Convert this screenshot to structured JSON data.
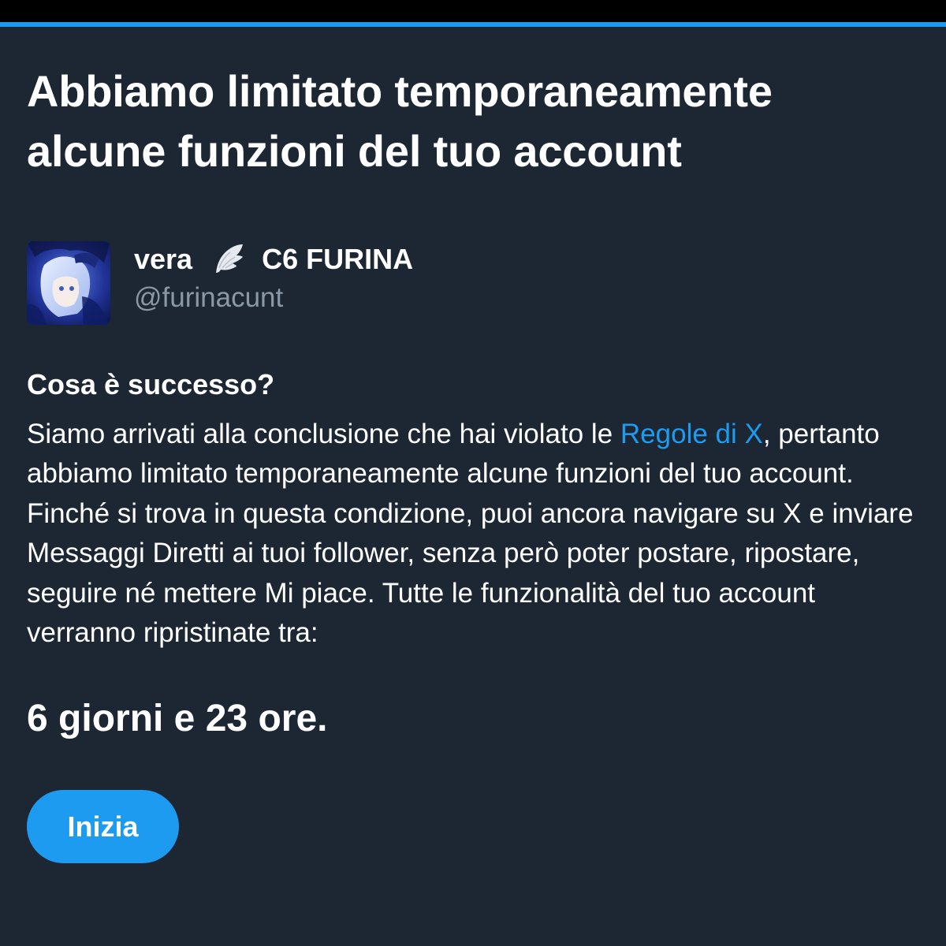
{
  "header": {
    "title": "Abbiamo limitato temporaneamente alcune funzioni del tuo account"
  },
  "account": {
    "display_name_prefix": "vera",
    "display_name_suffix": "C6 FURINA",
    "emoji_icon": "wing-icon",
    "handle": "@furinacunt"
  },
  "details": {
    "heading": "Cosa è successo?",
    "text_before_link": "Siamo arrivati alla conclusione che hai violato le ",
    "link_text": "Regole di X",
    "text_after_link": ", pertanto abbiamo limitato temporaneamente alcune funzioni del tuo account. Finché si trova in questa condizione, puoi ancora navigare su X e inviare Messaggi Diretti ai tuoi follower, senza però poter postare, ripostare, seguire né mettere Mi piace. Tutte le funzionalità del tuo account verranno ripristinate tra:"
  },
  "countdown": {
    "text": "6 giorni e 23 ore."
  },
  "actions": {
    "start_label": "Inizia"
  },
  "colors": {
    "background": "#1c2733",
    "accent": "#1d9bf0",
    "text_primary": "#ffffff",
    "text_secondary": "#8b98a5"
  }
}
